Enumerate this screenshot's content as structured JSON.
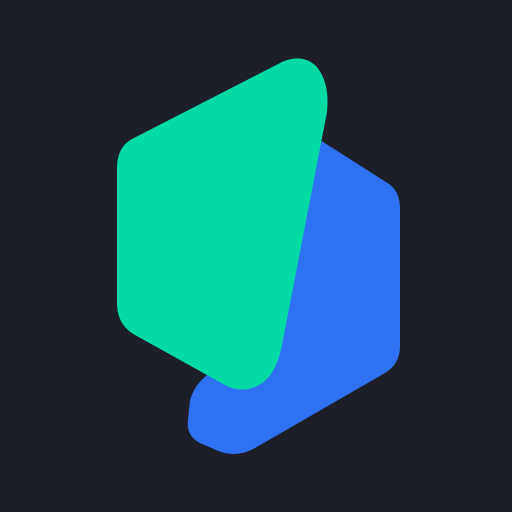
{
  "app_icon": {
    "name": "app-logo",
    "colors": {
      "background": "#1c1e28",
      "front_shape": "#03dba5",
      "back_shape": "#2e72f3"
    }
  }
}
